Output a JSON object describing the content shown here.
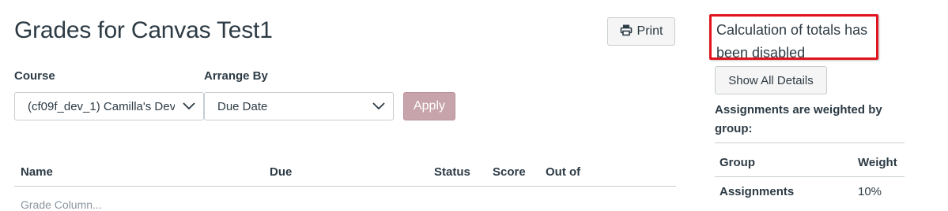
{
  "page": {
    "title": "Grades for Canvas Test1",
    "print_label": "Print"
  },
  "filters": {
    "course_label": "Course",
    "course_value": "(cf09f_dev_1) Camilla's Dev",
    "arrange_label": "Arrange By",
    "arrange_value": "Due Date",
    "apply_label": "Apply"
  },
  "table": {
    "columns": [
      "Name",
      "Due",
      "Status",
      "Score",
      "Out of"
    ],
    "partial_row": "Grade Column..."
  },
  "sidebar": {
    "notice": "Calculation of totals has been disabled",
    "show_details_label": "Show All Details",
    "weighted_heading": "Assignments are weighted by group:",
    "weights_header": {
      "group": "Group",
      "weight": "Weight"
    },
    "weights": [
      {
        "group": "Assignments",
        "weight": "10%"
      }
    ]
  },
  "icons": {
    "print": "printer-icon",
    "chevron": "chevron-down-icon"
  },
  "colors": {
    "apply_button": "#c7a4ab",
    "notice_border": "#e0141c",
    "text": "#2d3b45"
  }
}
